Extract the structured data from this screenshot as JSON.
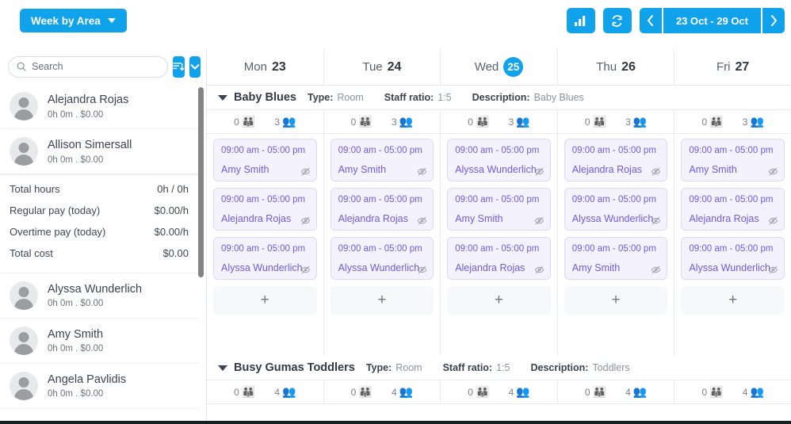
{
  "topbar": {
    "view_button": "Week by Area",
    "chart_icon": "bar-chart-icon",
    "refresh_icon": "refresh-icon",
    "prev_label": "‹",
    "next_label": "›",
    "date_range": "23 Oct - 29 Oct"
  },
  "sidebar": {
    "search_placeholder": "Search",
    "search_value": "",
    "sort_icon": "sort-icon",
    "filter_icon": "chevron-down-icon",
    "employees": [
      {
        "name": "Alejandra Rojas",
        "sub": "0h 0m  .  $0.00"
      },
      {
        "name": "Allison Simersall",
        "sub": "0h 0m  .  $0.00"
      },
      {
        "name": "Alyssa Wunderlich",
        "sub": "0h 0m  .  $0.00"
      },
      {
        "name": "Amy Smith",
        "sub": "0h 0m  .  $0.00"
      },
      {
        "name": "Angela Pavlidis",
        "sub": "0h 0m  .  $0.00"
      }
    ],
    "detail_after_index": 1,
    "detail": [
      {
        "key": "Total hours",
        "value": "0h / 0h"
      },
      {
        "key": "Regular pay (today)",
        "value": "$0.00/h"
      },
      {
        "key": "Overtime pay (today)",
        "value": "$0.00/h"
      },
      {
        "key": "Total cost",
        "value": "$0.00"
      }
    ]
  },
  "grid": {
    "days": [
      {
        "name": "Mon",
        "num": "23",
        "today": false
      },
      {
        "name": "Tue",
        "num": "24",
        "today": false
      },
      {
        "name": "Wed",
        "num": "25",
        "today": true
      },
      {
        "name": "Thu",
        "num": "26",
        "today": false
      },
      {
        "name": "Fri",
        "num": "27",
        "today": false
      }
    ],
    "areas": [
      {
        "title": "Baby Blues",
        "type_label": "Type:",
        "type_value": "Room",
        "ratio_label": "Staff ratio:",
        "ratio_value": "1:5",
        "desc_label": "Description:",
        "desc_value": "Baby Blues",
        "counts": [
          {
            "children": "0",
            "staff": "3"
          },
          {
            "children": "0",
            "staff": "3"
          },
          {
            "children": "0",
            "staff": "3"
          },
          {
            "children": "0",
            "staff": "3"
          },
          {
            "children": "0",
            "staff": "3"
          }
        ],
        "columns": [
          [
            {
              "time": "09:00 am - 05:00 pm",
              "name": "Amy Smith"
            },
            {
              "time": "09:00 am - 05:00 pm",
              "name": "Alejandra Rojas"
            },
            {
              "time": "09:00 am - 05:00 pm",
              "name": "Alyssa Wunderlich"
            }
          ],
          [
            {
              "time": "09:00 am - 05:00 pm",
              "name": "Amy Smith"
            },
            {
              "time": "09:00 am - 05:00 pm",
              "name": "Alejandra Rojas"
            },
            {
              "time": "09:00 am - 05:00 pm",
              "name": "Alyssa Wunderlich"
            }
          ],
          [
            {
              "time": "09:00 am - 05:00 pm",
              "name": "Alyssa Wunderlich"
            },
            {
              "time": "09:00 am - 05:00 pm",
              "name": "Amy Smith"
            },
            {
              "time": "09:00 am - 05:00 pm",
              "name": "Alejandra Rojas"
            }
          ],
          [
            {
              "time": "09:00 am - 05:00 pm",
              "name": "Alejandra Rojas"
            },
            {
              "time": "09:00 am - 05:00 pm",
              "name": "Alyssa Wunderlich"
            },
            {
              "time": "09:00 am - 05:00 pm",
              "name": "Amy Smith"
            }
          ],
          [
            {
              "time": "09:00 am - 05:00 pm",
              "name": "Amy Smith"
            },
            {
              "time": "09:00 am - 05:00 pm",
              "name": "Alejandra Rojas"
            },
            {
              "time": "09:00 am - 05:00 pm",
              "name": "Alyssa Wunderlich"
            }
          ]
        ],
        "add_label": "+"
      },
      {
        "title": "Busy Gumas Toddlers",
        "type_label": "Type:",
        "type_value": "Room",
        "ratio_label": "Staff ratio:",
        "ratio_value": "1:5",
        "desc_label": "Description:",
        "desc_value": "Toddlers",
        "counts": [
          {
            "children": "0",
            "staff": "4"
          },
          {
            "children": "0",
            "staff": "4"
          },
          {
            "children": "0",
            "staff": "4"
          },
          {
            "children": "0",
            "staff": "4"
          },
          {
            "children": "0",
            "staff": "4"
          }
        ],
        "columns": [
          [],
          [],
          [],
          [],
          []
        ],
        "add_label": "+"
      }
    ],
    "icons": {
      "children_icon": "children-group-icon",
      "staff_icon": "staff-group-icon",
      "hidden_icon": "eye-off-icon",
      "collapse_icon": "chevron-down-icon"
    }
  },
  "colors": {
    "accent": "#11a2ec",
    "shift_text": "#6f5ce0",
    "shift_bg": "#f4f2fd",
    "staff_icon": "#e8903a"
  }
}
